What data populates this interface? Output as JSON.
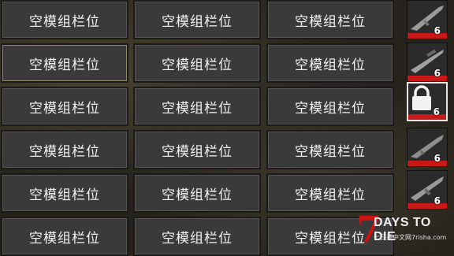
{
  "slots": {
    "empty_label": "空模组栏位"
  },
  "side_mods": [
    {
      "count": "6",
      "locked": false,
      "icon": "rifle-icon"
    },
    {
      "count": "6",
      "locked": false,
      "icon": "sniper-rifle-icon"
    },
    {
      "count": "6",
      "locked": true,
      "icon": "lock-icon"
    },
    {
      "count": "6",
      "locked": false,
      "icon": "shotgun-icon"
    },
    {
      "count": "6",
      "locked": false,
      "icon": "assault-rifle-icon"
    }
  ],
  "logo": {
    "seven": "7",
    "title": "DAYS TO DIE",
    "subtitle": "七日杀中文网7risha.com"
  },
  "colors": {
    "accent_red": "#c81818",
    "slot_bg": "#3a3a3a"
  }
}
